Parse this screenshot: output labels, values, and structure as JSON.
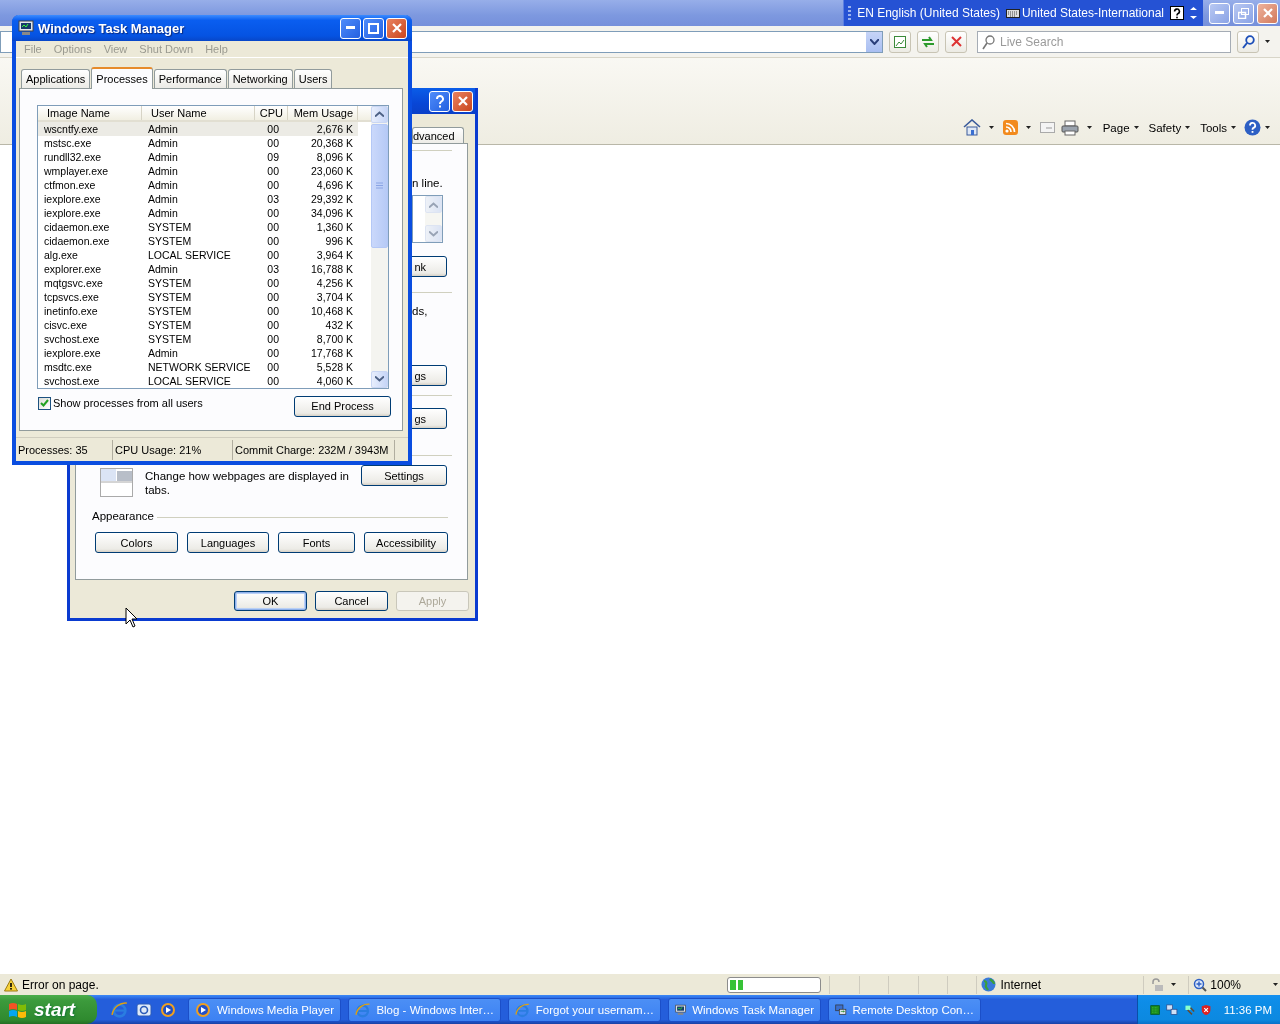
{
  "browser": {
    "language_bar": {
      "language": "EN English (United States)",
      "keyboard": "United States-International"
    },
    "search": {
      "placeholder": "Live Search"
    },
    "command_bar": [
      "Page",
      "Safety",
      "Tools"
    ],
    "status_bar": {
      "message": "Error on page.",
      "progress": {
        "level": 0.15
      },
      "zone": "Internet",
      "zoom": "100%"
    }
  },
  "internet_options": {
    "tabs": [
      {
        "label": "dvanced",
        "selected": false
      }
    ],
    "fragments": [
      {
        "kind": "text",
        "text": "n line."
      },
      {
        "kind": "listbox"
      },
      {
        "kind": "button",
        "text": "nk"
      },
      {
        "kind": "text",
        "text": "ds,"
      },
      {
        "kind": "button",
        "text": "gs"
      },
      {
        "kind": "button",
        "text": "gs"
      }
    ],
    "tabs_section": {
      "text": "Change how webpages are displayed in tabs.",
      "button": "Settings"
    },
    "appearance": {
      "title": "Appearance",
      "buttons": [
        "Colors",
        "Languages",
        "Fonts",
        "Accessibility"
      ]
    },
    "footer": [
      {
        "label": "OK",
        "default": true,
        "disabled": false
      },
      {
        "label": "Cancel",
        "default": false,
        "disabled": false
      },
      {
        "label": "Apply",
        "default": false,
        "disabled": true
      }
    ]
  },
  "task_manager": {
    "title": "Windows Task Manager",
    "menu": [
      "File",
      "Options",
      "View",
      "Shut Down",
      "Help"
    ],
    "tabs": [
      {
        "label": "Applications",
        "selected": false
      },
      {
        "label": "Processes",
        "selected": true
      },
      {
        "label": "Performance",
        "selected": false
      },
      {
        "label": "Networking",
        "selected": false
      },
      {
        "label": "Users",
        "selected": false
      }
    ],
    "columns": [
      "Image Name",
      "User Name",
      "CPU",
      "Mem Usage"
    ],
    "rows": [
      {
        "cells": [
          "wscntfy.exe",
          "Admin",
          "00",
          "2,676 K"
        ],
        "selected": true
      },
      {
        "cells": [
          "mstsc.exe",
          "Admin",
          "00",
          "20,368 K"
        ],
        "selected": false
      },
      {
        "cells": [
          "rundll32.exe",
          "Admin",
          "09",
          "8,096 K"
        ],
        "selected": false
      },
      {
        "cells": [
          "wmplayer.exe",
          "Admin",
          "00",
          "23,060 K"
        ],
        "selected": false
      },
      {
        "cells": [
          "ctfmon.exe",
          "Admin",
          "00",
          "4,696 K"
        ],
        "selected": false
      },
      {
        "cells": [
          "iexplore.exe",
          "Admin",
          "03",
          "29,392 K"
        ],
        "selected": false
      },
      {
        "cells": [
          "iexplore.exe",
          "Admin",
          "00",
          "34,096 K"
        ],
        "selected": false
      },
      {
        "cells": [
          "cidaemon.exe",
          "SYSTEM",
          "00",
          "1,360 K"
        ],
        "selected": false
      },
      {
        "cells": [
          "cidaemon.exe",
          "SYSTEM",
          "00",
          "996 K"
        ],
        "selected": false
      },
      {
        "cells": [
          "alg.exe",
          "LOCAL SERVICE",
          "00",
          "3,964 K"
        ],
        "selected": false
      },
      {
        "cells": [
          "explorer.exe",
          "Admin",
          "03",
          "16,788 K"
        ],
        "selected": false
      },
      {
        "cells": [
          "mqtgsvc.exe",
          "SYSTEM",
          "00",
          "4,256 K"
        ],
        "selected": false
      },
      {
        "cells": [
          "tcpsvcs.exe",
          "SYSTEM",
          "00",
          "3,704 K"
        ],
        "selected": false
      },
      {
        "cells": [
          "inetinfo.exe",
          "SYSTEM",
          "00",
          "10,468 K"
        ],
        "selected": false
      },
      {
        "cells": [
          "cisvc.exe",
          "SYSTEM",
          "00",
          "432 K"
        ],
        "selected": false
      },
      {
        "cells": [
          "svchost.exe",
          "SYSTEM",
          "00",
          "8,700 K"
        ],
        "selected": false
      },
      {
        "cells": [
          "iexplore.exe",
          "Admin",
          "00",
          "17,768 K"
        ],
        "selected": false
      },
      {
        "cells": [
          "msdtc.exe",
          "NETWORK SERVICE",
          "00",
          "5,528 K"
        ],
        "selected": false
      },
      {
        "cells": [
          "svchost.exe",
          "LOCAL SERVICE",
          "00",
          "4,060 K"
        ],
        "selected": false
      }
    ],
    "show_all": {
      "label": "Show processes from all users",
      "checked": true
    },
    "end_button": "End Process",
    "status": [
      "Processes: 35",
      "CPU Usage: 21%",
      "Commit Charge: 232M / 3943M"
    ]
  },
  "taskbar": {
    "start": "start",
    "tasks": [
      {
        "kind": "media",
        "label": "Windows Media Player"
      },
      {
        "kind": "browser",
        "label": "Blog - Windows Inter…"
      },
      {
        "kind": "browser",
        "label": "Forgot your usernam…"
      },
      {
        "kind": "taskmgr",
        "label": "Windows Task Manager"
      },
      {
        "kind": "remote",
        "label": "Remote Desktop Con…"
      }
    ],
    "clock": "11:36 PM"
  }
}
